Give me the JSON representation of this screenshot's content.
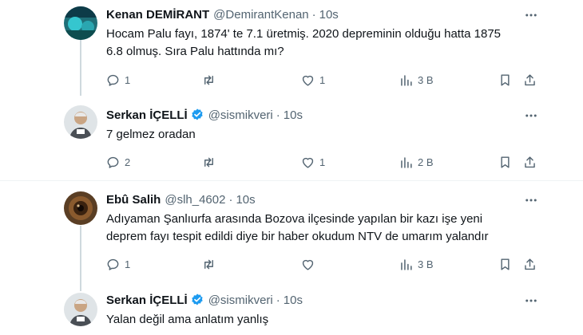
{
  "tweets": [
    {
      "name": "Kenan DEMİRANT",
      "handle": "@DemirantKenan",
      "time": "10s",
      "verified": false,
      "text_lines": [
        "Hocam Palu fayı, 1874' te 7.1 üretmiş. 2020 depreminin olduğu hatta 1875",
        "6.8 olmuş. Sıra Palu hattında mı?"
      ],
      "replies": "1",
      "retweets": "",
      "likes": "1",
      "views": "3 B"
    },
    {
      "name": "Serkan İÇELLİ",
      "handle": "@sismikveri",
      "time": "10s",
      "verified": true,
      "text_lines": [
        "7 gelmez oradan"
      ],
      "replies": "2",
      "retweets": "",
      "likes": "1",
      "views": "2 B"
    },
    {
      "name": "Ebû Salih",
      "handle": "@slh_4602",
      "time": "10s",
      "verified": false,
      "text_lines": [
        "Adıyaman Şanlıurfa arasında Bozova ilçesinde yapılan bir kazı işe yeni",
        "deprem fayı tespit edildi diye bir haber okudum NTV de umarım yalandır"
      ],
      "replies": "1",
      "retweets": "",
      "likes": "",
      "views": "3 B"
    },
    {
      "name": "Serkan İÇELLİ",
      "handle": "@sismikveri",
      "time": "10s",
      "verified": true,
      "text_lines": [
        "Yalan değil ama anlatım yanlış"
      ]
    }
  ],
  "icons": {
    "reply": "reply-icon",
    "retweet": "retweet-icon",
    "like": "like-icon",
    "views": "views-icon",
    "bookmark": "bookmark-icon",
    "share": "share-icon",
    "more": "more-icon",
    "verified": "verified-badge-icon"
  },
  "colors": {
    "text": "#0f1419",
    "muted": "#536471",
    "verified": "#1d9bf0",
    "thread_line": "#cfd9de",
    "divider": "#eff3f4"
  }
}
